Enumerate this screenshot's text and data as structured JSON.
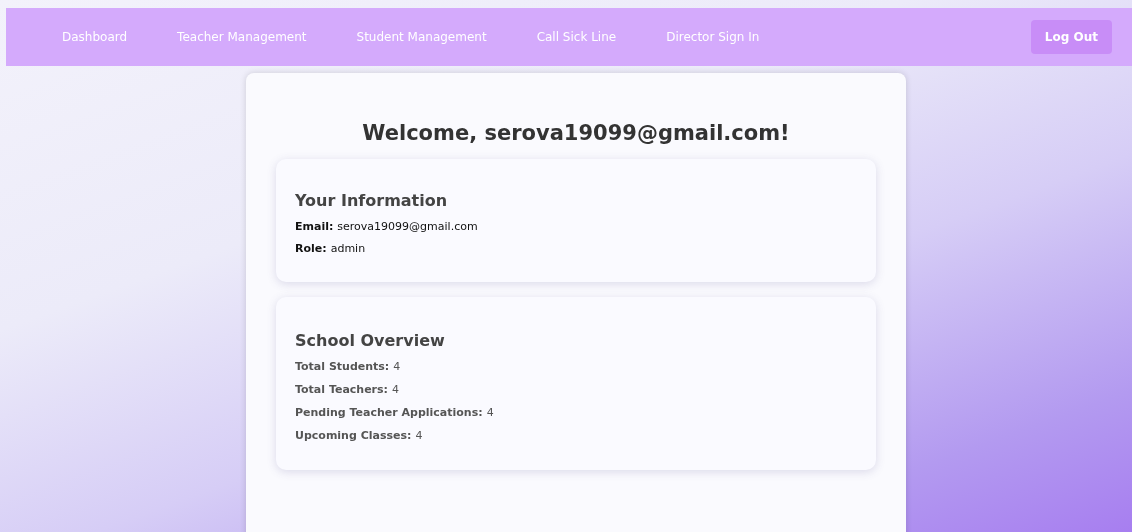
{
  "nav": {
    "links": [
      {
        "label": "Dashboard"
      },
      {
        "label": "Teacher Management"
      },
      {
        "label": "Student Management"
      },
      {
        "label": "Call Sick Line"
      },
      {
        "label": "Director Sign In"
      }
    ],
    "logout": "Log Out"
  },
  "welcome": "Welcome, serova19099@gmail.com!",
  "info": {
    "title": "Your Information",
    "rows": [
      {
        "label": "Email:",
        "value": "serova19099@gmail.com"
      },
      {
        "label": "Role:",
        "value": "admin"
      }
    ]
  },
  "overview": {
    "title": "School Overview",
    "rows": [
      {
        "label": "Total Students:",
        "value": "4"
      },
      {
        "label": "Total Teachers:",
        "value": "4"
      },
      {
        "label": "Pending Teacher Applications:",
        "value": "4"
      },
      {
        "label": "Upcoming Classes:",
        "value": "4"
      }
    ]
  }
}
